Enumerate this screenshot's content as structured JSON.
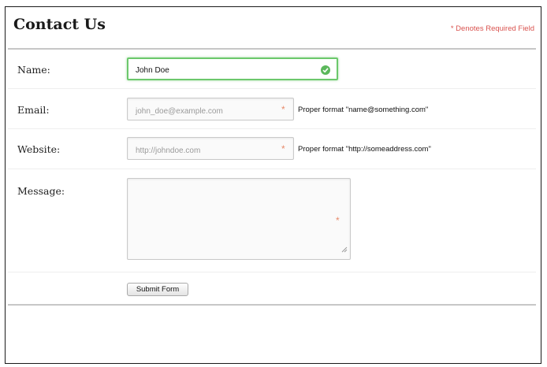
{
  "form": {
    "title": "Contact Us",
    "required_note": "* Denotes Required Field",
    "name": {
      "label": "Name:",
      "value": "John Doe"
    },
    "email": {
      "label": "Email:",
      "placeholder": "john_doe@example.com",
      "required_mark": "*",
      "hint": "Proper format \"name@something.com\""
    },
    "website": {
      "label": "Website:",
      "placeholder": "http://johndoe.com",
      "required_mark": "*",
      "hint": "Proper format \"http://someaddress.com\""
    },
    "message": {
      "label": "Message:",
      "required_mark": "*"
    },
    "submit_label": "Submit Form"
  },
  "colors": {
    "required": "#d9534f",
    "valid_border": "#6cc86c",
    "valid_icon": "#5cb85c",
    "required_star": "#e88a6a"
  },
  "icons": {
    "valid": "checkmark-icon",
    "resize": "resize-grip-icon"
  }
}
